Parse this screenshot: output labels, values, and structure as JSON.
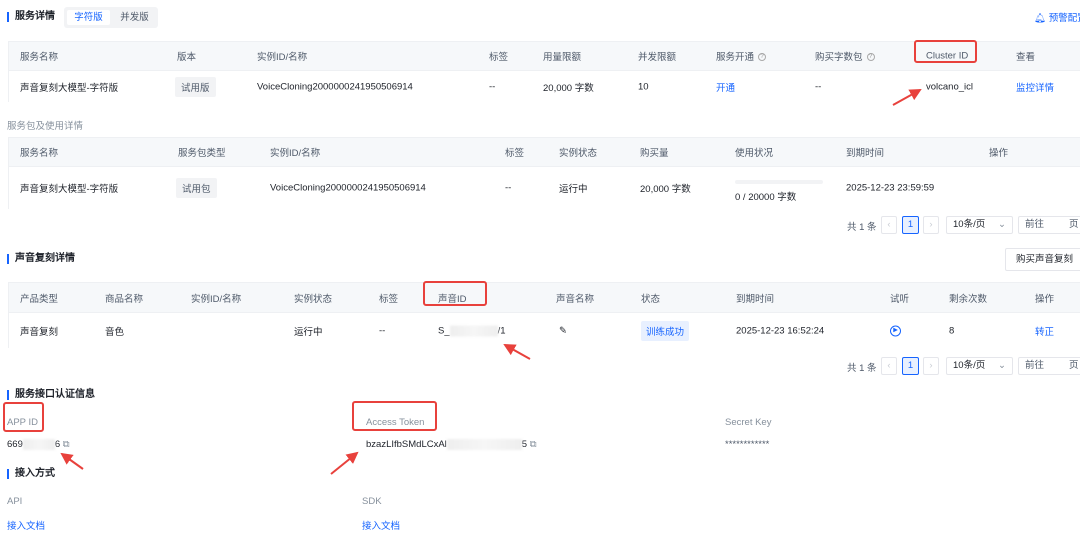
{
  "service_details": {
    "title": "服务详情",
    "tabs": [
      {
        "label": "字符版",
        "active": true
      },
      {
        "label": "并发版",
        "active": false
      }
    ],
    "alert_config": "预警配置",
    "headers": [
      "服务名称",
      "版本",
      "实例ID/名称",
      "标签",
      "用量限额",
      "并发限额",
      "服务开通",
      "购买字数包",
      "Cluster ID",
      "查看"
    ],
    "row": {
      "name": "声音复刻大模型-字符版",
      "version": "试用版",
      "instance": "VoiceCloning2000000241950506914",
      "tag": "--",
      "usage": "20,000 字数",
      "concurrency": "10",
      "activate": "开通",
      "package": "--",
      "cluster": "volcano_icl",
      "view": "监控详情"
    }
  },
  "package_details": {
    "title": "服务包及使用详情",
    "headers": [
      "服务名称",
      "服务包类型",
      "实例ID/名称",
      "标签",
      "实例状态",
      "购买量",
      "使用状况",
      "到期时间",
      "操作"
    ],
    "row": {
      "name": "声音复刻大模型-字符版",
      "type": "试用包",
      "instance": "VoiceCloning2000000241950506914",
      "tag": "--",
      "status": "运行中",
      "amount": "20,000 字数",
      "usage_text": "0 / 20000 字数",
      "usage_fraction": 0,
      "expire": "2025-12-23 23:59:59"
    }
  },
  "pagination": {
    "total": "共 1 条",
    "page": "1",
    "page_size": "10条/页",
    "goto": "前往",
    "page_unit": "页"
  },
  "clone_details": {
    "title": "声音复刻详情",
    "buy_button": "购买声音复刻",
    "headers": [
      "产品类型",
      "商品名称",
      "实例ID/名称",
      "实例状态",
      "标签",
      "声音ID",
      "声音名称",
      "状态",
      "到期时间",
      "试听",
      "剩余次数",
      "操作"
    ],
    "row": {
      "product": "声音复刻",
      "goods": "音色",
      "instance": "",
      "status": "运行中",
      "tag": "--",
      "voice_id_prefix": "S_",
      "voice_id_suffix": "/1",
      "state": "训练成功",
      "expire": "2025-12-23 16:52:24",
      "remaining": "8",
      "action": "转正"
    }
  },
  "auth": {
    "title": "服务接口认证信息",
    "app_id_label": "APP ID",
    "app_id_prefix": "669",
    "app_id_suffix": "6",
    "token_label": "Access Token",
    "token_prefix": "bzazLIfbSMdLCxAl",
    "token_suffix": "5",
    "secret_label": "Secret Key",
    "secret_value": "************"
  },
  "access": {
    "title": "接入方式",
    "api_label": "API",
    "api_link": "接入文档",
    "sdk_label": "SDK",
    "sdk_link": "接入文档"
  },
  "colors": {
    "accent": "#1664ff",
    "annotation": "#e8413c"
  }
}
